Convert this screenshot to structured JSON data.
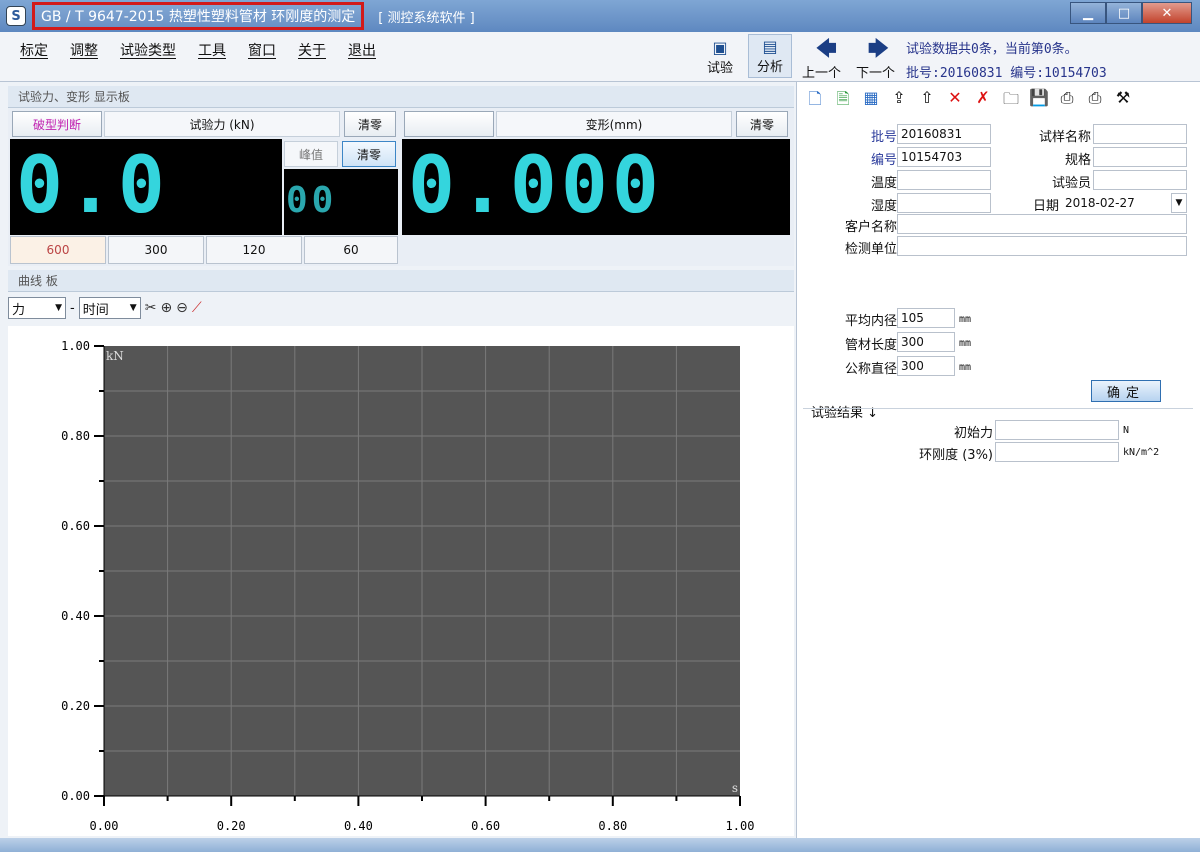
{
  "window": {
    "icon": "S",
    "title": "GB / T 9647-2015 热塑性塑料管材 环刚度的测定",
    "subtitle": "[ 测控系统软件 ]",
    "minimize": "▁",
    "maximize": "□",
    "close": "✕"
  },
  "menu": [
    "标定",
    "调整",
    "试验类型",
    "工具",
    "窗口",
    "关于",
    "退出"
  ],
  "modes": {
    "test": "试验",
    "analysis": "分析"
  },
  "nav": {
    "prev": "上一个",
    "next": "下一个",
    "summary": "试验数据共0条，当前第0条。",
    "batch": "批号:20160831  编号:10154703"
  },
  "display": {
    "panel_title": "试验力、变形 显示板",
    "break_label": "破型判断",
    "force_label": "试验力 (kN)",
    "clear": "清零",
    "peak": "峰值",
    "peak_clear": "清零",
    "deform_label": "变形(mm)",
    "deform_clear": "清零",
    "force_value": "0.0",
    "peak_value": "00",
    "deform_value": "0.000",
    "ranges": [
      "600",
      "300",
      "120",
      "60"
    ]
  },
  "curve": {
    "panel_title": "曲线 板",
    "y_select": "力",
    "x_select": "时间"
  },
  "chart_data": {
    "type": "line",
    "series": [],
    "xlim": [
      0,
      1
    ],
    "ylim": [
      0,
      1
    ],
    "x_ticks": [
      "0.00",
      "0.20",
      "0.40",
      "0.60",
      "0.80",
      "1.00"
    ],
    "y_ticks": [
      "0.00",
      "0.20",
      "0.40",
      "0.60",
      "0.80",
      "1.00"
    ],
    "ylabel": "kN",
    "xlabel": "s",
    "grid": true,
    "background": "#555555",
    "grid_color": "#7a7a7a"
  },
  "form": {
    "batch_label": "批号",
    "batch_value": "20160831",
    "number_label": "编号",
    "number_value": "10154703",
    "temp_label": "温度",
    "humidity_label": "湿度",
    "sample_name_label": "试样名称",
    "spec_label": "规格",
    "tester_label": "试验员",
    "date_label": "日期",
    "date_value": "2018-02-27",
    "customer_label": "客户名称",
    "unit_label": "检测单位",
    "inner_diam_label": "平均内径",
    "inner_diam_value": "105",
    "length_label": "管材长度",
    "length_value": "300",
    "nominal_diam_label": "公称直径",
    "nominal_diam_value": "300",
    "mm": "mm",
    "ok": "确定",
    "results_label": "试验结果 ↓",
    "init_force_label": "初始力",
    "init_force_unit": "N",
    "stiffness_label": "环刚度 (3%)",
    "stiffness_unit": "kN/m^2"
  }
}
